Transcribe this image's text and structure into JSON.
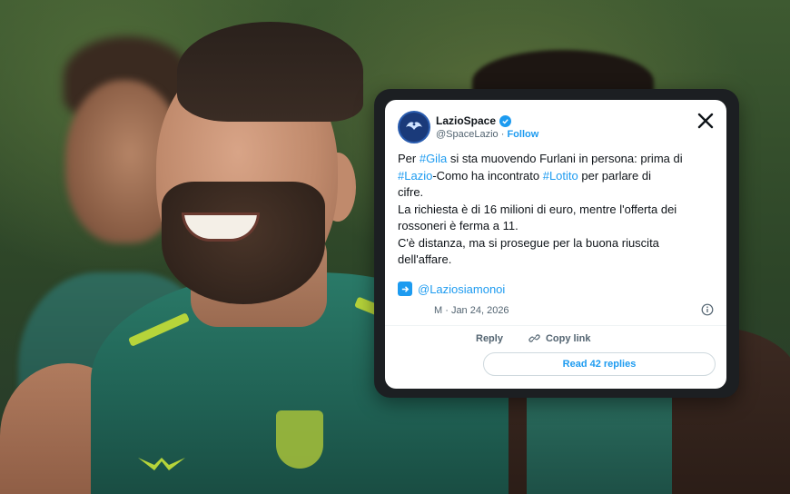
{
  "tweet": {
    "display_name": "LazioSpace",
    "handle": "@SpaceLazio",
    "separator": "·",
    "follow_label": "Follow",
    "body": {
      "line1_prefix": "Per ",
      "hashtag1": "#Gila",
      "line1_suffix": " si sta muovendo Furlani in persona: prima di",
      "hashtag2": "#Lazio",
      "line2_mid": "-Como ha incontrato ",
      "hashtag3": "#Lotito",
      "line2_suffix": " per parlare di",
      "line3": "cifre.",
      "line4": "La richiesta è di 16 milioni di euro, mentre l'offerta dei",
      "line5": "rossoneri è ferma a 11.",
      "line6": "C'è distanza, ma si prosegue per la buona riuscita",
      "line7": "dell'affare."
    },
    "quoted_handle": "@Laziosiamonoi",
    "date_fragment": "M · Jan 24, 2026",
    "actions": {
      "reply_label": "Reply",
      "copy_link_label": "Copy link"
    },
    "read_replies_label": "Read 42 replies",
    "colors": {
      "link_blue": "#1d9bf0",
      "text": "#0f1419",
      "muted": "#536471"
    }
  },
  "icons": {
    "verified": "verified-badge-icon",
    "x_logo": "x-logo-icon",
    "link": "link-icon",
    "info": "info-icon",
    "arrow": "arrow-right-icon",
    "avatar": "eagle-avatar-icon"
  }
}
